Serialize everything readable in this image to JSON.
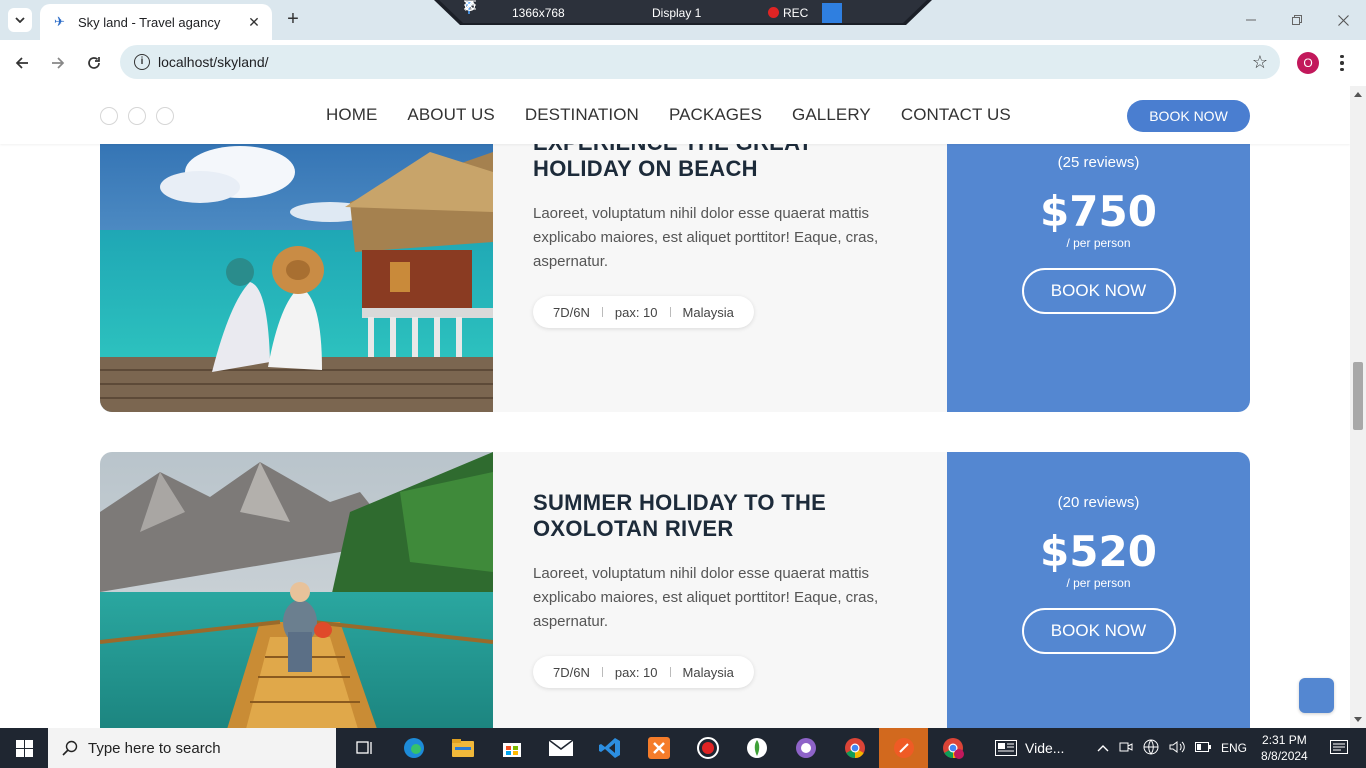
{
  "browser": {
    "tab_title": "Sky land - Travel agancy",
    "url": "localhost/skyland/",
    "profile_initial": "O"
  },
  "recorder": {
    "resolution": "1366x768",
    "display": "Display 1",
    "rec_label": "REC"
  },
  "site": {
    "nav": [
      "HOME",
      "ABOUT US",
      "DESTINATION",
      "PACKAGES",
      "GALLERY",
      "CONTACT US"
    ],
    "book_now": "BOOK NOW"
  },
  "packages": [
    {
      "title_line1": "EXPERIENCE THE GREAT",
      "title_line2": "HOLIDAY ON BEACH",
      "description": "Laoreet, voluptatum nihil dolor esse quaerat mattis explicabo maiores, est aliquet porttitor! Eaque, cras, aspernatur.",
      "duration": "7D/6N",
      "pax": "pax: 10",
      "location": "Malaysia",
      "reviews": "(25 reviews)",
      "price": "$750",
      "per": "/ per person",
      "button": "BOOK NOW"
    },
    {
      "title_line1": "SUMMER HOLIDAY TO THE",
      "title_line2": "OXOLOTAN RIVER",
      "description": "Laoreet, voluptatum nihil dolor esse quaerat mattis explicabo maiores, est aliquet porttitor! Eaque, cras, aspernatur.",
      "duration": "7D/6N",
      "pax": "pax: 10",
      "location": "Malaysia",
      "reviews": "(20 reviews)",
      "price": "$520",
      "per": "/ per person",
      "button": "BOOK NOW"
    }
  ],
  "taskbar": {
    "search_placeholder": "Type here to search",
    "video_label": "Vide...",
    "language": "ENG",
    "time": "2:31 PM",
    "date": "8/8/2024"
  },
  "colors": {
    "accent": "#5487d1",
    "header_button": "#4a7ed0",
    "taskbar": "#1f2631"
  }
}
